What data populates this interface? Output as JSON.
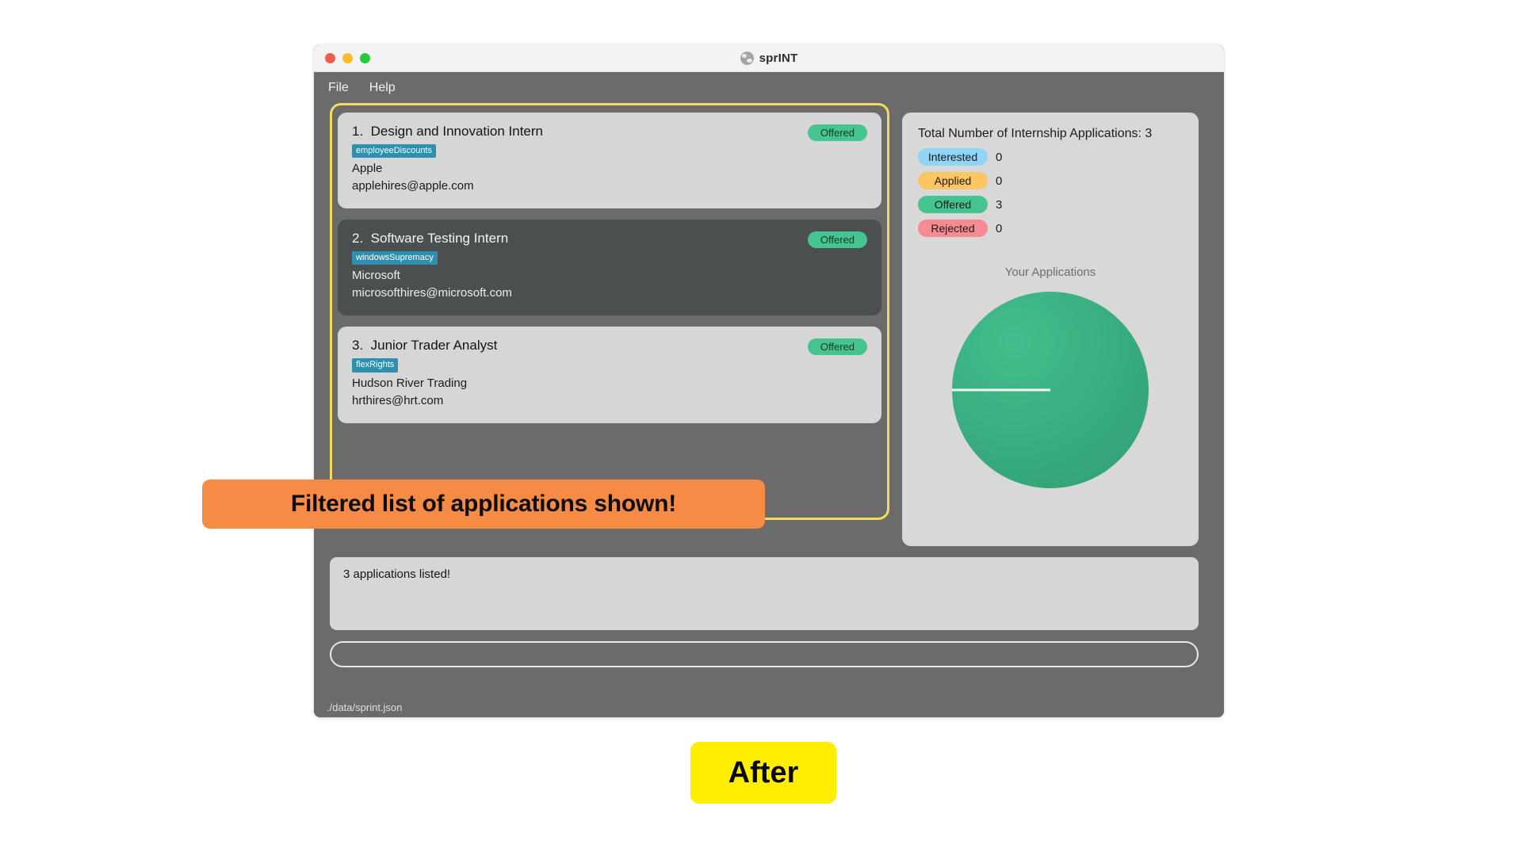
{
  "window": {
    "app_title": "sprINT",
    "app_icon": "globe-icon",
    "traffic_lights": [
      "close-button",
      "minimize-button",
      "maximize-button"
    ]
  },
  "menubar": {
    "items": [
      {
        "label": "File"
      },
      {
        "label": "Help"
      }
    ]
  },
  "applications": [
    {
      "title": "1.  Design and Innovation Intern",
      "tag": "employeeDiscounts",
      "company": "Apple",
      "email": "applehires@apple.com",
      "status": "Offered",
      "selected": false
    },
    {
      "title": "2.  Software Testing Intern",
      "tag": "windowsSupremacy",
      "company": "Microsoft",
      "email": "microsofthires@microsoft.com",
      "status": "Offered",
      "selected": true
    },
    {
      "title": "3.  Junior Trader Analyst",
      "tag": "flexRights",
      "company": "Hudson River Trading",
      "email": "hrthires@hrt.com",
      "status": "Offered",
      "selected": false
    }
  ],
  "stats": {
    "title": "Total Number of Internship Applications: 3",
    "rows": [
      {
        "label": "Interested",
        "count": "0",
        "color": "#8fd5f5"
      },
      {
        "label": "Applied",
        "count": "0",
        "color": "#fbc663"
      },
      {
        "label": "Offered",
        "count": "3",
        "color": "#45c48f"
      },
      {
        "label": "Rejected",
        "count": "0",
        "color": "#f78a92"
      }
    ]
  },
  "chart_data": {
    "type": "pie",
    "title": "Your Applications",
    "categories": [
      "Interested",
      "Applied",
      "Offered",
      "Rejected"
    ],
    "values": [
      0,
      0,
      3,
      0
    ],
    "percentages": [
      0,
      0,
      100,
      0
    ],
    "colors": [
      "#8fd5f5",
      "#fbc663",
      "#34a578",
      "#f78a92"
    ],
    "legend": "none",
    "start_angle_deg": 180,
    "notes": "Single full slice: Offered = 3 (100%); white radius line drawn at 180 degrees"
  },
  "log": {
    "message": "3 applications listed!"
  },
  "command_input": {
    "value": "",
    "placeholder": ""
  },
  "statusbar": {
    "path": "./data/sprint.json"
  },
  "annotations": {
    "banner_text": "Filtered list of applications shown!",
    "banner_color": "#f68b45",
    "after_label": "After",
    "after_color": "#ffee00",
    "highlight_color": "#f5db5c"
  }
}
